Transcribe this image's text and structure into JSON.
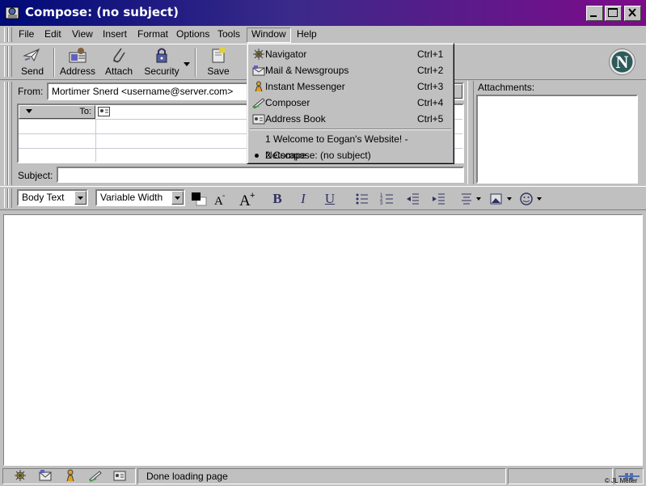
{
  "window": {
    "title": "Compose: (no subject)"
  },
  "menu": [
    "File",
    "Edit",
    "View",
    "Insert",
    "Format",
    "Options",
    "Tools",
    "Window",
    "Help"
  ],
  "toolbar": {
    "send": "Send",
    "address": "Address",
    "attach": "Attach",
    "security": "Security",
    "save": "Save"
  },
  "header": {
    "from_label": "From:",
    "from_value": "Mortimer Snerd <username@server.com>",
    "to_label": "To:",
    "subject_label": "Subject:",
    "subject_value": "",
    "attachments_label": "Attachments:"
  },
  "window_menu": {
    "items": [
      {
        "label": "Navigator",
        "shortcut": "Ctrl+1",
        "icon": "navigator-icon"
      },
      {
        "label": "Mail & Newsgroups",
        "shortcut": "Ctrl+2",
        "icon": "mail-newsgroups-icon"
      },
      {
        "label": "Instant Messenger",
        "shortcut": "Ctrl+3",
        "icon": "instant-messenger-icon"
      },
      {
        "label": "Composer",
        "shortcut": "Ctrl+4",
        "icon": "composer-icon"
      },
      {
        "label": "Address Book",
        "shortcut": "Ctrl+5",
        "icon": "address-book-icon"
      }
    ],
    "windows": [
      {
        "label": "1 Welcome to Eogan's Website! - Netscape",
        "selected": false
      },
      {
        "label": "2 Compose: (no subject)",
        "selected": true
      }
    ]
  },
  "format": {
    "paragraph": "Body Text",
    "font": "Variable Width",
    "bold": "B",
    "italic": "I",
    "underline": "U"
  },
  "status": {
    "text": "Done loading page",
    "credit": "© JL Meller"
  },
  "colors": {
    "titlebar_start": "#000a78",
    "titlebar_end": "#7e0a8a",
    "face": "#c0c0c0"
  }
}
